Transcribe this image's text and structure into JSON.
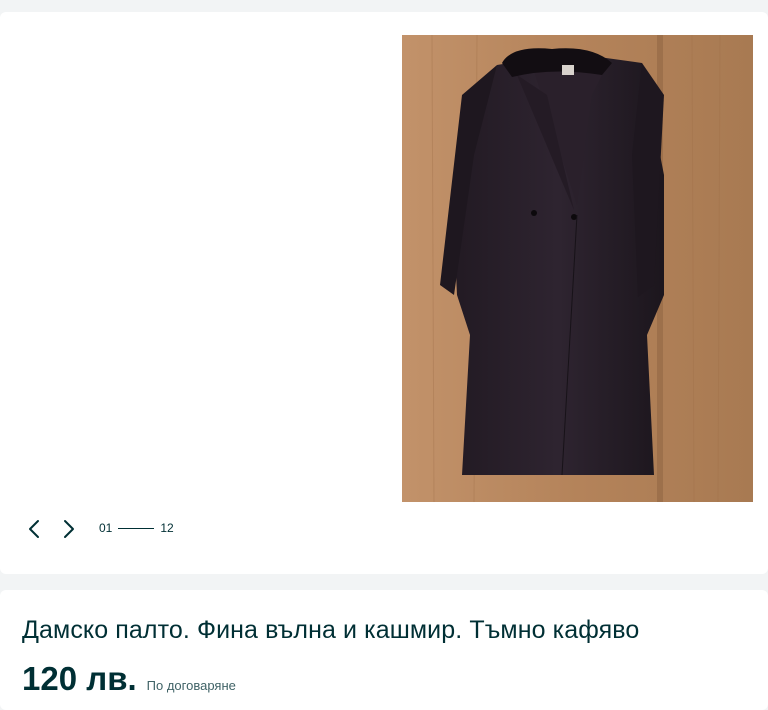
{
  "gallery": {
    "current": "01",
    "total": "12",
    "prev_icon": "chevron-left-icon",
    "next_icon": "chevron-right-icon"
  },
  "listing": {
    "title": "Дамско палто. Фина вълна и кашмир. Тъмно кафяво",
    "price": "120 лв.",
    "price_note": "По договаряне"
  },
  "colors": {
    "text": "#002f34",
    "muted": "#406367",
    "page_bg": "#f2f4f5"
  }
}
